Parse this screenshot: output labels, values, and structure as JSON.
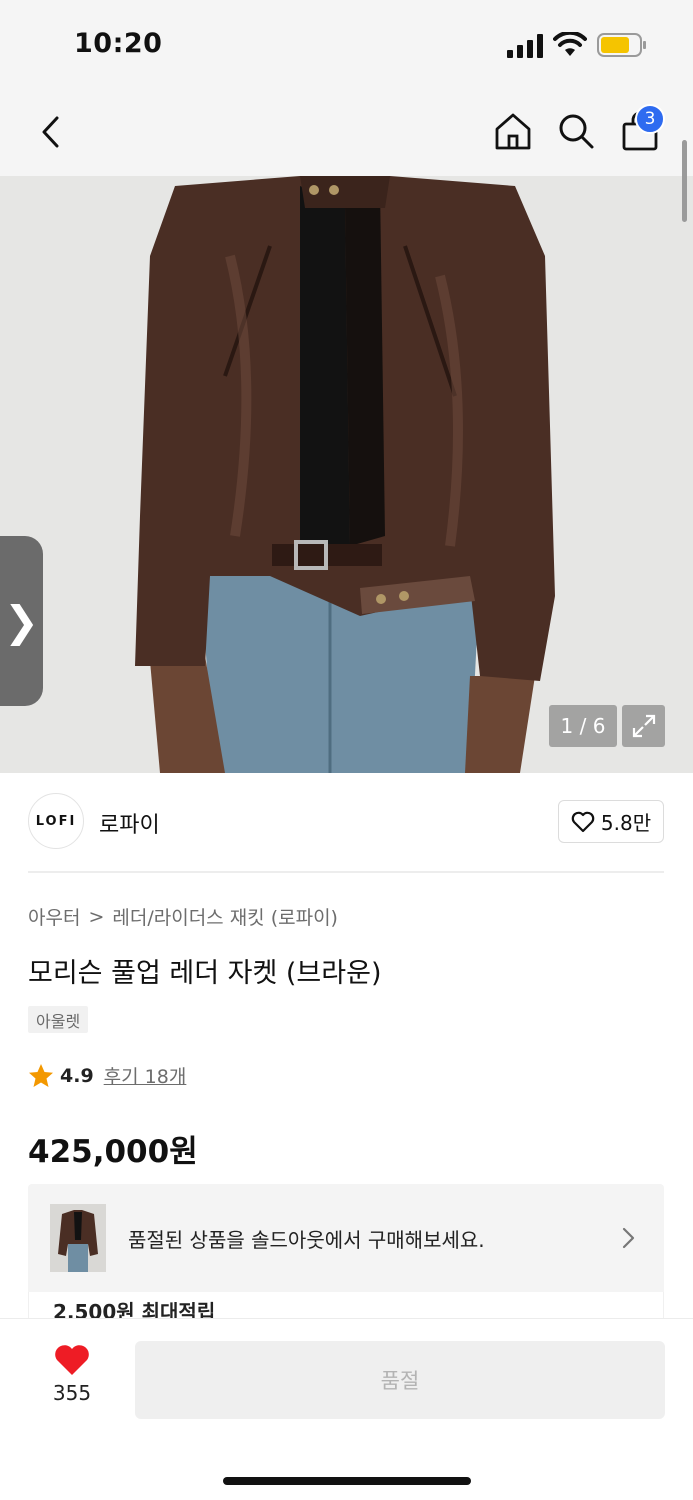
{
  "status_bar": {
    "time": "10:20"
  },
  "nav": {
    "cart_count": "3"
  },
  "gallery": {
    "counter": "1 / 6",
    "side_tab_glyph": "❯"
  },
  "brand": {
    "logo_text": "LOFI",
    "name": "로파이",
    "likes": "5.8만"
  },
  "breadcrumb": {
    "category": "아우터",
    "separator": ">",
    "subcategory": "레더/라이더스 재킷 (로파이)"
  },
  "product": {
    "title": "모리슨 풀업 레더 자켓 (브라운)",
    "tag": "아울렛",
    "rating": "4.9",
    "reviews": "후기 18개",
    "price": "425,000원"
  },
  "soldout_banner": {
    "text": "품절된 상품을 솔드아웃에서 구매해보세요."
  },
  "points": {
    "text": "2,500원 최대적립"
  },
  "bottom": {
    "wish_count": "355",
    "action_label": "품절"
  },
  "colors": {
    "accent_blue": "#2e6bf0",
    "heart_red": "#ee1c25",
    "star_orange": "#f39800"
  }
}
